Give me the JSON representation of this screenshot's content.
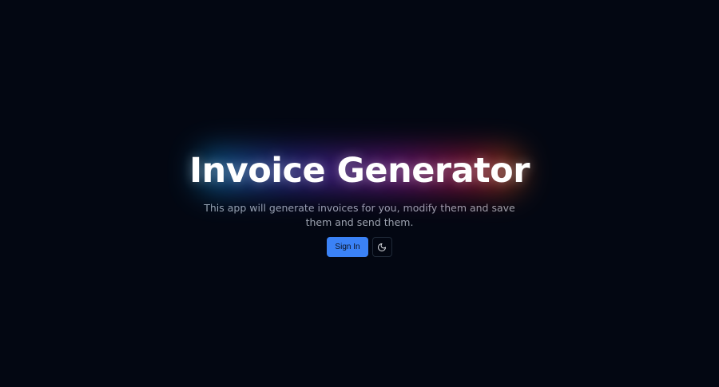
{
  "hero": {
    "title": "Invoice Generator",
    "subtitle": "This app will generate invoices for you, modify them and save them and send them."
  },
  "actions": {
    "sign_in_label": "Sign In",
    "theme_toggle_icon": "moon-icon"
  },
  "colors": {
    "background": "#030712",
    "primary": "#3b82f6",
    "title": "#ffffff",
    "subtitle": "#9ca3af"
  }
}
